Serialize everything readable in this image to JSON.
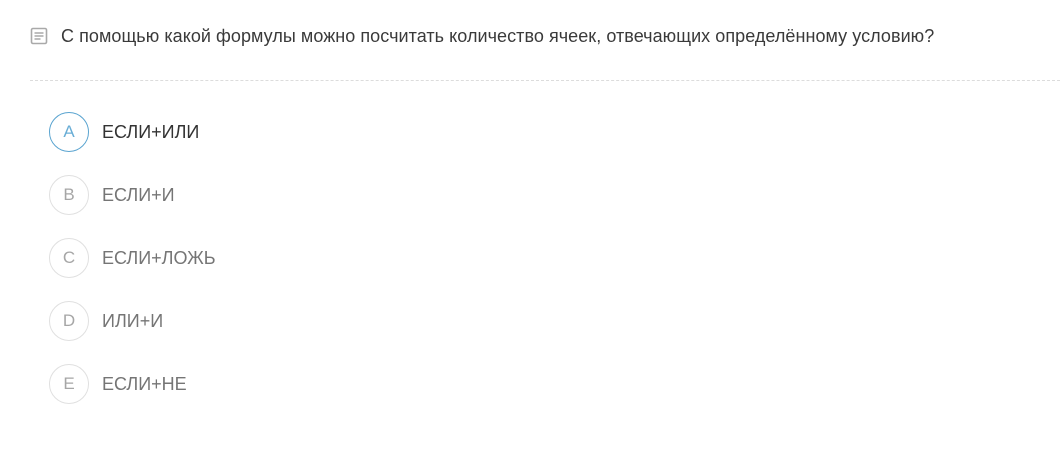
{
  "question": {
    "icon": "document-lines-icon",
    "text": "С помощью какой формулы можно посчитать количество ячеек, отвечающих определённому условию?"
  },
  "options": [
    {
      "letter": "A",
      "label": "ЕСЛИ+ИЛИ",
      "highlighted": true
    },
    {
      "letter": "B",
      "label": "ЕСЛИ+И",
      "highlighted": false
    },
    {
      "letter": "C",
      "label": "ЕСЛИ+ЛОЖЬ",
      "highlighted": false
    },
    {
      "letter": "D",
      "label": "ИЛИ+И",
      "highlighted": false
    },
    {
      "letter": "E",
      "label": "ЕСЛИ+НЕ",
      "highlighted": false
    }
  ],
  "colors": {
    "accent": "#5aa4d0",
    "text": "#333333",
    "muted_text": "#757575",
    "circle_border": "#e0e0e0"
  }
}
